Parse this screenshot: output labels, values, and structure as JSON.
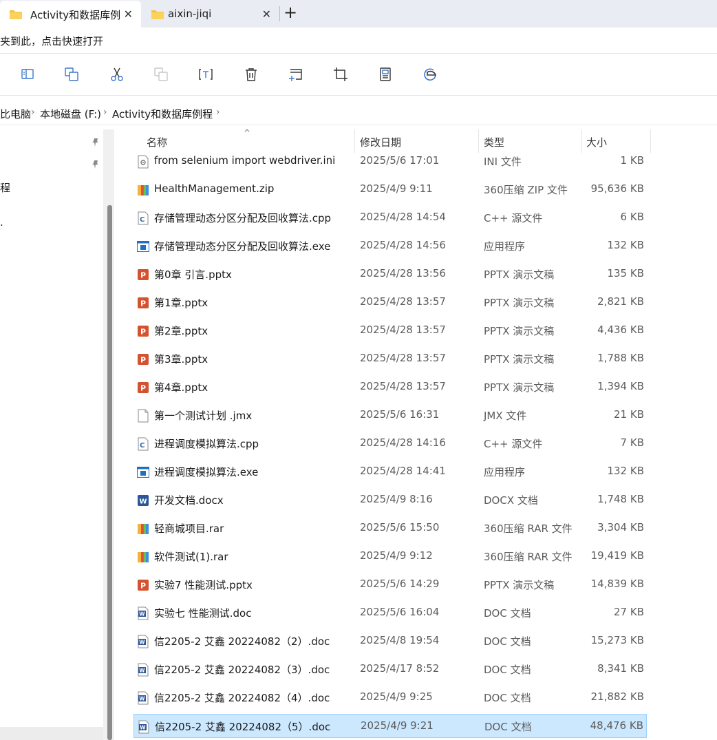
{
  "tabs": [
    {
      "title": "Activity和数据库例",
      "active": true
    },
    {
      "title": "aixin-jiqi",
      "active": false
    }
  ],
  "new_tab_glyph": "+",
  "close_glyph": "✕",
  "hint_text": "夹到此，点击快速打开",
  "breadcrumb": [
    "比电脑",
    "本地磁盘 (F:)",
    "Activity和数据库例程"
  ],
  "nav": {
    "label_a": "程",
    "label_b": "."
  },
  "columns": {
    "name": "名称",
    "date": "修改日期",
    "type": "类型",
    "size": "大小"
  },
  "files": [
    {
      "icon": "ini-file-icon",
      "name": "from selenium import webdriver.ini",
      "date": "2025/5/6 17:01",
      "type": "INI 文件",
      "size": "1 KB"
    },
    {
      "icon": "archive-icon",
      "name": "HealthManagement.zip",
      "date": "2025/4/9 9:11",
      "type": "360压缩 ZIP 文件",
      "size": "95,636 KB"
    },
    {
      "icon": "cpp-file-icon",
      "name": "存储管理动态分区分配及回收算法.cpp",
      "date": "2025/4/28 14:54",
      "type": "C++ 源文件",
      "size": "6 KB"
    },
    {
      "icon": "exe-file-icon",
      "name": "存储管理动态分区分配及回收算法.exe",
      "date": "2025/4/28 14:56",
      "type": "应用程序",
      "size": "132 KB"
    },
    {
      "icon": "pptx-file-icon",
      "name": "第0章 引言.pptx",
      "date": "2025/4/28 13:56",
      "type": "PPTX 演示文稿",
      "size": "135 KB"
    },
    {
      "icon": "pptx-file-icon",
      "name": "第1章.pptx",
      "date": "2025/4/28 13:57",
      "type": "PPTX 演示文稿",
      "size": "2,821 KB"
    },
    {
      "icon": "pptx-file-icon",
      "name": "第2章.pptx",
      "date": "2025/4/28 13:57",
      "type": "PPTX 演示文稿",
      "size": "4,436 KB"
    },
    {
      "icon": "pptx-file-icon",
      "name": "第3章.pptx",
      "date": "2025/4/28 13:57",
      "type": "PPTX 演示文稿",
      "size": "1,788 KB"
    },
    {
      "icon": "pptx-file-icon",
      "name": "第4章.pptx",
      "date": "2025/4/28 13:57",
      "type": "PPTX 演示文稿",
      "size": "1,394 KB"
    },
    {
      "icon": "blank-file-icon",
      "name": "第一个测试计划 .jmx",
      "date": "2025/5/6 16:31",
      "type": "JMX 文件",
      "size": "21 KB"
    },
    {
      "icon": "cpp-file-icon",
      "name": "进程调度模拟算法.cpp",
      "date": "2025/4/28 14:16",
      "type": "C++ 源文件",
      "size": "7 KB"
    },
    {
      "icon": "exe-file-icon",
      "name": "进程调度模拟算法.exe",
      "date": "2025/4/28 14:41",
      "type": "应用程序",
      "size": "132 KB"
    },
    {
      "icon": "docx-file-icon",
      "name": "开发文档.docx",
      "date": "2025/4/9 8:16",
      "type": "DOCX 文档",
      "size": "1,748 KB"
    },
    {
      "icon": "archive-icon",
      "name": "轻商城项目.rar",
      "date": "2025/5/6 15:50",
      "type": "360压缩 RAR 文件",
      "size": "3,304 KB"
    },
    {
      "icon": "archive-icon",
      "name": "软件测试(1).rar",
      "date": "2025/4/9 9:12",
      "type": "360压缩 RAR 文件",
      "size": "19,419 KB"
    },
    {
      "icon": "pptx-file-icon",
      "name": "实验7 性能测试.pptx",
      "date": "2025/5/6 14:29",
      "type": "PPTX 演示文稿",
      "size": "14,839 KB"
    },
    {
      "icon": "doc-file-icon",
      "name": "实验七 性能测试.doc",
      "date": "2025/5/6 16:04",
      "type": "DOC 文档",
      "size": "27 KB"
    },
    {
      "icon": "doc-file-icon",
      "name": "信2205-2 艾鑫 20224082（2）.doc",
      "date": "2025/4/8 19:54",
      "type": "DOC 文档",
      "size": "15,273 KB"
    },
    {
      "icon": "doc-file-icon",
      "name": "信2205-2 艾鑫 20224082（3）.doc",
      "date": "2025/4/17 8:52",
      "type": "DOC 文档",
      "size": "8,341 KB"
    },
    {
      "icon": "doc-file-icon",
      "name": "信2205-2 艾鑫 20224082（4）.doc",
      "date": "2025/4/9 9:25",
      "type": "DOC 文档",
      "size": "21,882 KB"
    },
    {
      "icon": "doc-file-icon",
      "name": "信2205-2 艾鑫 20224082（5）.doc",
      "date": "2025/4/9 9:21",
      "type": "DOC 文档",
      "size": "48,476 KB",
      "selected": true
    }
  ],
  "colors": {
    "tabstrip": "#e9edf3",
    "selection": "#cce8ff",
    "selection_border": "#99d1ff",
    "folder": "#f3c13a",
    "pptx": "#d35230",
    "word": "#2b579a",
    "exe": "#1e6fbf"
  }
}
